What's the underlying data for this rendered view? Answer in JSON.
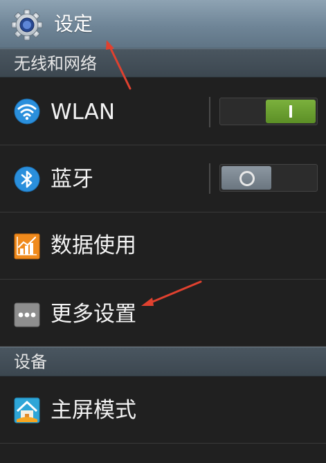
{
  "header": {
    "title": "设定",
    "icon": "gear-icon"
  },
  "sections": {
    "wireless": {
      "label": "无线和网络"
    },
    "device": {
      "label": "设备"
    }
  },
  "items": {
    "wlan": {
      "label": "WLAN",
      "icon": "wifi-icon",
      "toggle_on": true
    },
    "bluetooth": {
      "label": "蓝牙",
      "icon": "bluetooth-icon",
      "toggle_on": false
    },
    "data_usage": {
      "label": "数据使用",
      "icon": "data-usage-icon"
    },
    "more_settings": {
      "label": "更多设置",
      "icon": "more-icon"
    },
    "home_mode": {
      "label": "主屏模式",
      "icon": "home-icon"
    }
  },
  "colors": {
    "toggle_on": "#6fa534",
    "toggle_off": "#7a858f",
    "arrow": "#e0412f",
    "header": "#6f8597"
  }
}
